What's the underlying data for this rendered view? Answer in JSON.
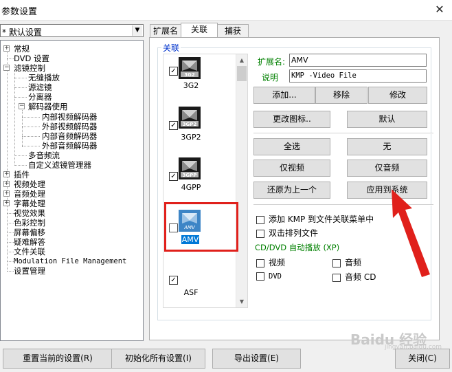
{
  "window": {
    "title": "参数设置",
    "close_glyph": "✕"
  },
  "profile": {
    "selected": "* 默认设置",
    "arrow": "▼"
  },
  "tree": {
    "items": [
      {
        "label": "常规",
        "expander": "+"
      },
      {
        "label": "DVD 设置"
      },
      {
        "label": "滤镜控制",
        "expander": "−"
      },
      {
        "label": "无缝播放"
      },
      {
        "label": "源滤镜"
      },
      {
        "label": "分离器"
      },
      {
        "label": "解码器使用",
        "expander": "−"
      },
      {
        "label": "内部视频解码器"
      },
      {
        "label": "外部视频解码器"
      },
      {
        "label": "内部音频解码器"
      },
      {
        "label": "外部音频解码器"
      },
      {
        "label": "多音频流"
      },
      {
        "label": "自定义滤镜管理器"
      },
      {
        "label": "插件",
        "expander": "+"
      },
      {
        "label": "视频处理",
        "expander": "+"
      },
      {
        "label": "音频处理",
        "expander": "+"
      },
      {
        "label": "字幕处理",
        "expander": "+"
      },
      {
        "label": "视觉效果"
      },
      {
        "label": "色彩控制"
      },
      {
        "label": "屏幕偏移"
      },
      {
        "label": "疑难解答"
      },
      {
        "label": "文件关联"
      },
      {
        "label": "Modulation File Management"
      },
      {
        "label": "设置管理"
      }
    ]
  },
  "tabs": [
    {
      "label": "扩展名"
    },
    {
      "label": "关联"
    },
    {
      "label": "捕获"
    }
  ],
  "group": {
    "caption": "关联"
  },
  "formats": [
    {
      "icon_text": "3G2",
      "label": "3G2",
      "checked": true,
      "check_glyph": "✓"
    },
    {
      "icon_text": "3GP2",
      "label": "3GP2",
      "checked": true,
      "check_glyph": "✓"
    },
    {
      "icon_text": "3GPP",
      "label": "4GPP",
      "checked": true,
      "check_glyph": "✓"
    },
    {
      "icon_text": "AMV",
      "label": "AMV",
      "checked": false,
      "check_glyph": ""
    },
    {
      "icon_text": "",
      "label": "ASF",
      "checked": true,
      "check_glyph": "✓"
    }
  ],
  "scroll": {
    "up": "▲",
    "down": "▼"
  },
  "detail": {
    "ext_label": "扩展名:",
    "ext_value": "AMV",
    "desc_label": "说明",
    "desc_value": "KMP -Video File"
  },
  "buttons": {
    "add": "添加...",
    "remove": "移除",
    "modify": "修改",
    "change_icon": "更改图标..",
    "default": "默认",
    "select_all": "全选",
    "none": "无",
    "video_only": "仅视频",
    "audio_only": "仅音频",
    "restore_prev": "还原为上一个",
    "apply_system": "应用到系统"
  },
  "options": {
    "add_kmp_menu": "添加 KMP 到文件关联菜单中",
    "double_sort": "双击排列文件",
    "autoplay_caption": "CD/DVD 自动播放 (XP)",
    "video": "视频",
    "audio": "音频",
    "dvd": "DVD",
    "audio_cd": "音频 CD"
  },
  "bottom": {
    "reset_current": "重置当前的设置(R)",
    "init_all": "初始化所有设置(I)",
    "export": "导出设置(E)",
    "close": "关闭(C)"
  },
  "watermark": {
    "brand": "Baidu 经验",
    "url": "jingyan.baidu.com"
  },
  "colors": {
    "highlight_box": "#e0201b",
    "arrow": "#e0201b",
    "group_caption": "#0033cc",
    "label_green": "#008000",
    "selection": "#0078d7"
  }
}
